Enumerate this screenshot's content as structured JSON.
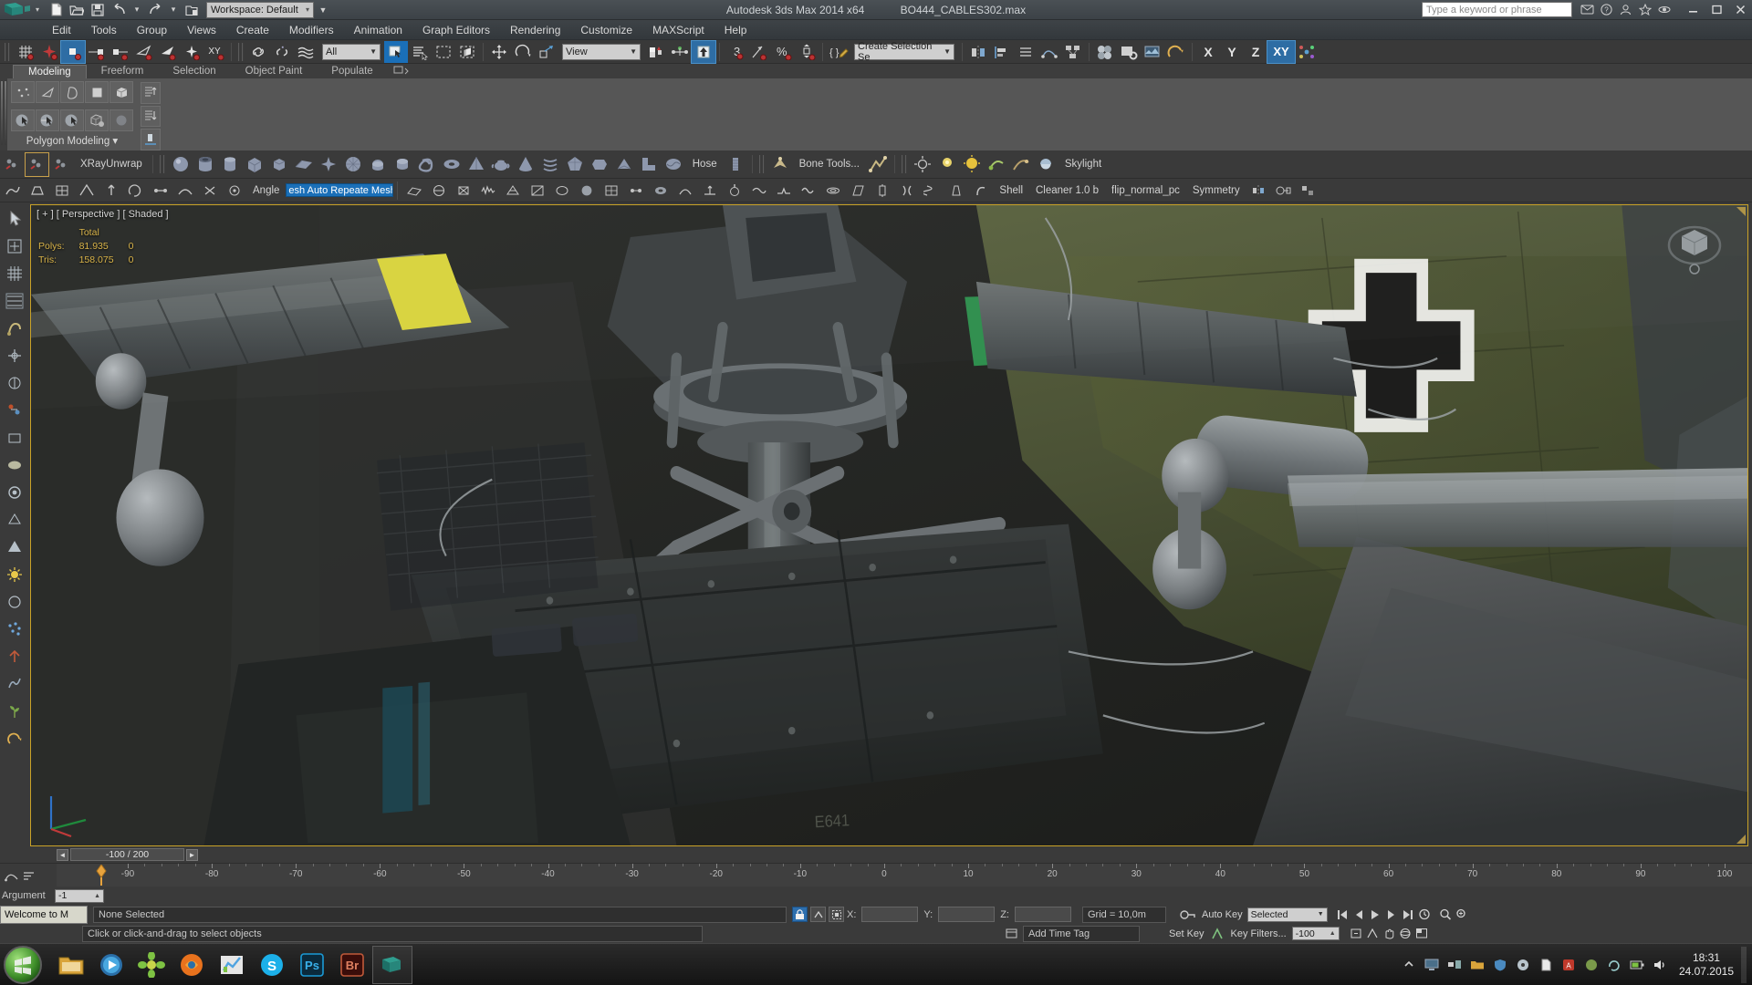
{
  "titlebar": {
    "app_title": "Autodesk 3ds Max  2014 x64",
    "file_name": "BO444_CABLES302.max",
    "workspace": "Workspace: Default",
    "workspace_arrow": "▾",
    "search_placeholder": "Type a keyword or phrase",
    "quick_access": [
      {
        "name": "new-file-icon",
        "label": "New"
      },
      {
        "name": "open-file-icon",
        "label": "Open"
      },
      {
        "name": "save-file-icon",
        "label": "Save"
      },
      {
        "name": "undo-icon",
        "label": "Undo"
      },
      {
        "name": "undo-dropdown-icon",
        "label": "▾"
      },
      {
        "name": "redo-icon",
        "label": "Redo"
      },
      {
        "name": "redo-dropdown-icon",
        "label": "▾"
      },
      {
        "name": "set-project-folder-icon",
        "label": "Project Folder"
      }
    ],
    "window_buttons": [
      "–",
      "❐",
      "✕"
    ]
  },
  "menubar": {
    "items": [
      "Edit",
      "Tools",
      "Group",
      "Views",
      "Create",
      "Modifiers",
      "Animation",
      "Graph Editors",
      "Rendering",
      "Customize",
      "MAXScript",
      "Help"
    ]
  },
  "main_toolbar": {
    "selection_filter": "All",
    "reference_coord_system": "View",
    "named_selection_sets": "Create Selection Se",
    "axis_labels": [
      "X",
      "Y",
      "Z",
      "XY"
    ],
    "pivot_count": "3",
    "percent_label": "%",
    "buttons": [
      "select-link-icon",
      "unlink-selection-icon",
      "bind-to-space-warp-icon",
      "select-object-icon",
      "select-by-name-icon",
      "rectangular-selection-region-icon",
      "window-crossing-icon",
      "select-and-move-icon",
      "select-and-rotate-icon",
      "select-and-scale-icon",
      "use-pivot-point-center-icon",
      "mirror-icon",
      "align-icon",
      "layer-manager-icon",
      "graph-editor-icon",
      "schematic-view-icon",
      "material-editor-icon",
      "render-setup-icon",
      "rendered-frame-window-icon",
      "render-production-icon"
    ]
  },
  "ribbon": {
    "tabs": [
      "Modeling",
      "Freeform",
      "Selection",
      "Object Paint",
      "Populate"
    ],
    "selected_tab": "Modeling",
    "panel_label": "Polygon Modeling",
    "panel_dropdown": "▾",
    "sub_object_icons": [
      "vertex-icon",
      "edge-icon",
      "border-icon",
      "polygon-icon",
      "element-icon"
    ],
    "row2_icons": [
      "generate-topology-icon",
      "swift-loop-icon",
      "paint-connect-icon",
      "nurms-toggle-icon",
      "use-nurms-icon"
    ],
    "side_icons": [
      "move-up-icon",
      "move-down-icon",
      "constraint-icon"
    ]
  },
  "toolbar_primitives": {
    "left_tools": [
      "xray-mesh-icon",
      "xray-unwrap-active-icon",
      "xray-face-icon"
    ],
    "xray_label": "XRayUnwrap",
    "primitive_icons": [
      "sphere-icon",
      "tube-icon",
      "cylinder-icon",
      "box-icon",
      "chamfer-box-icon",
      "plane-icon",
      "star-icon",
      "geosphere-icon",
      "capsule-icon",
      "oil-tank-icon",
      "torus-knot-icon",
      "torus-icon",
      "pyramid-icon",
      "teapot-icon",
      "cone-icon",
      "helix-icon",
      "hedra-icon",
      "gengon-icon",
      "prism-icon",
      "l-extrusion-icon",
      "liquid-icon"
    ],
    "hose_label": "Hose",
    "hose_icon": "hose-icon",
    "bone_tools_label": "Bone Tools...",
    "bone_icons": [
      "bone-icon",
      "ik-chain-icon"
    ],
    "light_icons": [
      "omni-light-icon",
      "target-spot-icon",
      "free-spot-icon",
      "target-direct-icon",
      "free-direct-icon",
      "skylight-icon",
      "mr-area-omni-icon",
      "mr-area-spot-icon",
      "daylight-icon",
      "sunlight-icon",
      "photometric-target-icon",
      "photometric-free-icon",
      "ies-sky-icon",
      "ies-sun-icon"
    ],
    "skylight_label": "Skylight"
  },
  "toolbar_modifiers": {
    "angle_label": "Angle",
    "highlighted_field": "esh Auto Repeate Mesh Insp",
    "left_icons": [
      "relax-icon",
      "chamfer-icon",
      "quadify-icon",
      "bevel-icon",
      "extrude-icon",
      "turn-to-poly-icon",
      "connect-icon",
      "bridge-icon",
      "weld-icon",
      "target-weld-icon",
      "cut-icon",
      "quickslice-icon",
      "msmooth-icon",
      "tessellate-icon",
      "attach-icon",
      "detach-icon"
    ],
    "right_icons": [
      "planar-icon",
      "spherify-icon",
      "lattice-icon",
      "noise-icon",
      "optimize-icon",
      "prooptimizer-icon",
      "meshsmooth-icon",
      "turbosmooth-icon",
      "subdivide-icon",
      "vertex-weld-icon",
      "cap-holes-icon",
      "smooth-icon",
      "normal-icon",
      "push-icon",
      "relax-mod-icon",
      "displace-icon",
      "wave-icon",
      "ripple-icon",
      "skew-icon",
      "stretch-icon",
      "squeeze-icon",
      "twist-icon",
      "taper-icon",
      "bend-icon"
    ],
    "shell_label": "Shell",
    "cleaner_label": "Cleaner 1.0 b",
    "flip_normal_label": "flip_normal_pc",
    "symmetry_label": "Symmetry",
    "end_icons": [
      "mirror-mod-icon",
      "morpher-icon",
      "hsds-icon"
    ]
  },
  "left_rail": {
    "icons": [
      "select-object-tool-icon",
      "move-tool-icon",
      "rotate-tool-icon",
      "scale-tool-icon",
      "snap-toggle-icon",
      "angle-snap-icon",
      "percent-snap-icon",
      "spinner-snap-icon",
      "box-create-icon",
      "sphere-create-icon",
      "cylinder-create-icon",
      "cone-create-icon",
      "pyramid-create-icon",
      "light-create-icon",
      "torus-create-icon",
      "particle-icon",
      "helper-icon",
      "spacewarp-icon",
      "plant-icon",
      "render-icon"
    ]
  },
  "viewport": {
    "label": "[ + ] [ Perspective ] [ Shaded ]",
    "stats_header": "Total",
    "stats": [
      {
        "label": "Polys:",
        "value": "81.935",
        "extra": "0"
      },
      {
        "label": "Tris:",
        "value": "158.075",
        "extra": "0"
      }
    ],
    "decal_text": "E641",
    "viewcube_name": "view-cube"
  },
  "timeline": {
    "left_arrow": "◄",
    "right_arrow": "►",
    "frame_display": "-100 / 200",
    "ticks": [
      "-90",
      "-80",
      "-70",
      "-60",
      "-50",
      "-40",
      "-30",
      "-20",
      "-10",
      "0",
      "10",
      "20",
      "30",
      "40",
      "50",
      "60",
      "70",
      "80",
      "90",
      "100"
    ]
  },
  "bottom": {
    "argument_label": "Argument",
    "argument_value": "-1",
    "welcome_label": "Welcome to M",
    "status_text": "None Selected",
    "prompt_text": "Click or click-and-drag to select objects",
    "coords": [
      {
        "label": "X:",
        "value": ""
      },
      {
        "label": "Y:",
        "value": ""
      },
      {
        "label": "Z:",
        "value": ""
      }
    ],
    "grid_label": "Grid = 10,0m",
    "add_time_tag": "Add Time Tag",
    "auto_key": "Auto Key",
    "set_key": "Set Key",
    "key_mode": "Selected",
    "key_filters": "Key Filters...",
    "key_field": "-100",
    "nav_icons": [
      "key-mode-toggle-icon",
      "go-to-start-icon",
      "previous-frame-icon",
      "play-icon",
      "next-frame-icon",
      "go-to-end-icon",
      "time-configuration-icon",
      "zoom-icon",
      "zoom-all-icon",
      "zoom-extents-icon",
      "field-of-view-icon",
      "pan-view-icon",
      "orbit-icon",
      "maximize-viewport-icon"
    ]
  },
  "taskbar": {
    "start_label": "start-orb",
    "apps": [
      {
        "name": "taskbar-windows-explorer",
        "glyph": "▤",
        "color": "#d9a43b"
      },
      {
        "name": "taskbar-media-player",
        "glyph": "▶",
        "color": "#3ca3d6"
      },
      {
        "name": "taskbar-photo-viewer",
        "glyph": "✸",
        "color": "#7ec243"
      },
      {
        "name": "taskbar-firefox",
        "glyph": "●",
        "color": "#e8721d"
      },
      {
        "name": "taskbar-chart-app",
        "glyph": "◤",
        "color": "#4fa3e0"
      },
      {
        "name": "taskbar-skype",
        "glyph": "S",
        "color": "#1cb0e9"
      },
      {
        "name": "taskbar-photoshop",
        "glyph": "Ps",
        "color": "#1b9ad6"
      },
      {
        "name": "taskbar-bridge",
        "glyph": "Br",
        "color": "#b1442b"
      },
      {
        "name": "taskbar-3dsmax-running",
        "glyph": "◆",
        "color": "#1a8a8a"
      }
    ],
    "tray_icons": [
      "tray-monitor-icon",
      "tray-network-icon",
      "tray-folder-icon",
      "tray-shield-icon",
      "tray-disc-icon",
      "tray-doc-icon",
      "tray-acrobat-icon",
      "tray-app-icon",
      "tray-sync-icon",
      "tray-battery-icon",
      "tray-volume-icon",
      "tray-chevron-icon"
    ],
    "time": "18:31",
    "date": "24.07.2015"
  }
}
